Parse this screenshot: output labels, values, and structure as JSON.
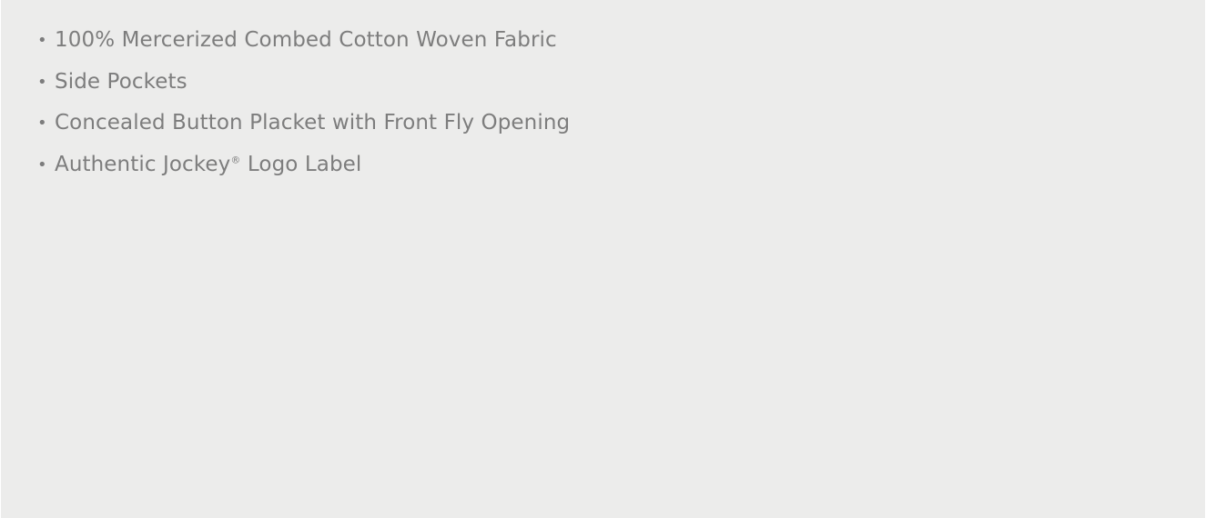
{
  "features": {
    "bullet_char": "•",
    "items": [
      {
        "text": "100% Mercerized Combed Cotton Woven Fabric"
      },
      {
        "text": "Side Pockets"
      },
      {
        "text": "Concealed Button Placket with Front Fly Opening"
      },
      {
        "text": "Authentic Jockey",
        "registered_mark": "®",
        "text_after": " Logo Label"
      }
    ]
  },
  "colors": {
    "background": "#ececeb",
    "text": "#7d7d7d"
  }
}
